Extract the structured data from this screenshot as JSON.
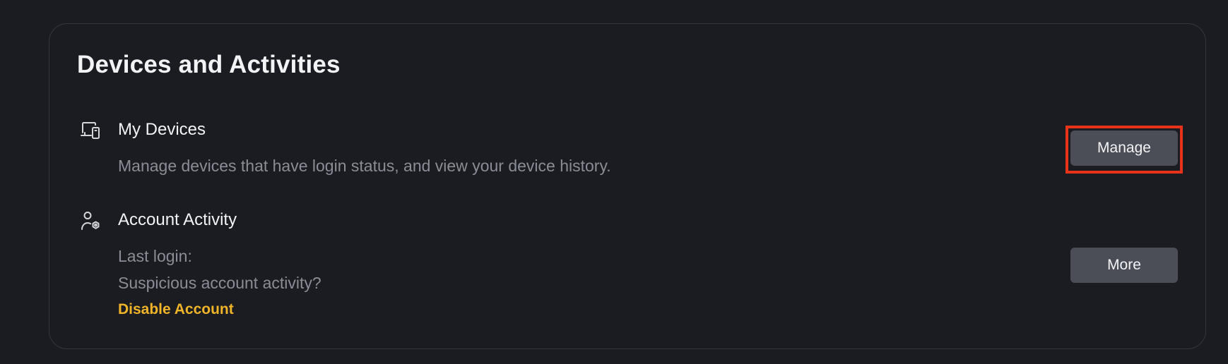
{
  "section": {
    "title": "Devices and Activities"
  },
  "my_devices": {
    "icon": "devices-icon",
    "title": "My Devices",
    "description": "Manage devices that have login status, and view your device history.",
    "button_label": "Manage"
  },
  "account_activity": {
    "icon": "user-settings-icon",
    "title": "Account Activity",
    "last_login_label": "Last login:",
    "suspicious_prompt": "Suspicious account activity?",
    "disable_link": "Disable Account",
    "button_label": "More"
  },
  "colors": {
    "background": "#1b1c22",
    "button": "#4b4e57",
    "link": "#f0b429",
    "highlight": "#e8321a",
    "muted_text": "#8a8d96"
  }
}
